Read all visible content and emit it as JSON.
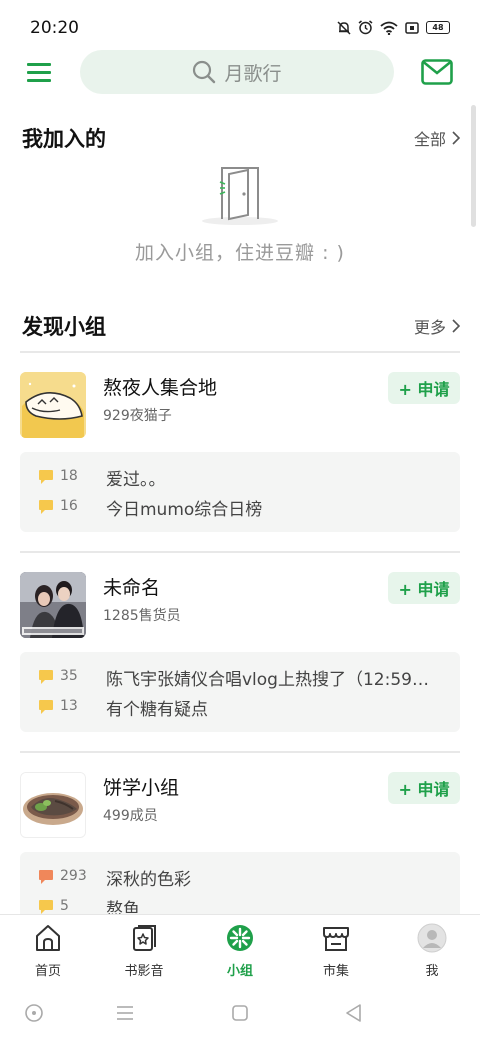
{
  "status_bar": {
    "time": "20:20",
    "battery": "48"
  },
  "search": {
    "placeholder": "月歌行"
  },
  "joined": {
    "title": "我加入的",
    "all_link": "全部",
    "empty_text": "加入小组，住进豆瓣 : )"
  },
  "discover": {
    "title": "发现小组",
    "more_link": "更多",
    "groups": [
      {
        "name": "熬夜人集合地",
        "members": "929夜猫子",
        "apply_label": "+ 申请",
        "posts": [
          {
            "count": "18",
            "title": "爱过。。",
            "bubble": "yellow"
          },
          {
            "count": "16",
            "title": "今日mumo综合日榜",
            "bubble": "yellow"
          }
        ]
      },
      {
        "name": "未命名",
        "members": "1285售货员",
        "apply_label": "+ 申请",
        "posts": [
          {
            "count": "35",
            "title": "陈飞宇张婧仪合唱vlog上热搜了（12:59总…",
            "bubble": "yellow"
          },
          {
            "count": "13",
            "title": "有个糖有疑点",
            "bubble": "yellow"
          }
        ]
      },
      {
        "name": "饼学小组",
        "members": "499成员",
        "apply_label": "+ 申请",
        "posts": [
          {
            "count": "293",
            "title": "深秋的色彩",
            "bubble": "orange"
          },
          {
            "count": "5",
            "title": "熬鱼",
            "bubble": "yellow"
          }
        ]
      }
    ]
  },
  "bottom_nav": [
    {
      "label": "首页",
      "icon": "home-icon"
    },
    {
      "label": "书影音",
      "icon": "book-movie-music-icon"
    },
    {
      "label": "小组",
      "icon": "group-icon",
      "active": true
    },
    {
      "label": "市集",
      "icon": "market-icon"
    },
    {
      "label": "我",
      "icon": "avatar-icon"
    }
  ],
  "colors": {
    "accent": "#1fa04a",
    "bubble_yellow": "#f6c84c",
    "bubble_orange": "#f0875a"
  }
}
